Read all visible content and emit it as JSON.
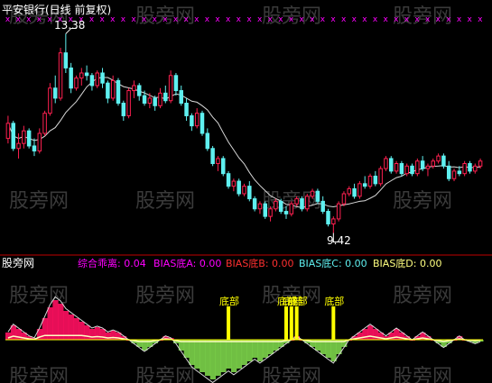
{
  "header": {
    "title": "平安银行(日线 前复权)"
  },
  "watermark": {
    "text": "股旁网"
  },
  "colors": {
    "background": "#000000",
    "up": "#ff2050",
    "down": "#5ff0f0",
    "divider": "#c00000",
    "ma_line": "#d8d8d8",
    "signal": "#ff00ff",
    "bias_pos": "#ff1060",
    "bias_neg": "#7cd44a",
    "bias_line": "#ffffc0",
    "bottom_marker": "#ffff00"
  },
  "chart_data": [
    {
      "type": "candlestick",
      "title": "平安银行(日线 前复权)",
      "annotations": {
        "high": "13.38",
        "low": "9.42"
      },
      "top_markers": "x",
      "ohlc": [
        [
          11.3,
          11.75,
          11.2,
          11.6
        ],
        [
          11.6,
          11.65,
          11.05,
          11.1
        ],
        [
          11.1,
          11.4,
          10.9,
          11.2
        ],
        [
          11.2,
          11.55,
          11.1,
          11.45
        ],
        [
          11.45,
          11.5,
          11.1,
          11.15
        ],
        [
          11.15,
          11.3,
          10.95,
          11.05
        ],
        [
          11.05,
          11.5,
          11.0,
          11.4
        ],
        [
          11.4,
          11.85,
          11.35,
          11.8
        ],
        [
          11.8,
          12.4,
          11.75,
          12.3
        ],
        [
          12.3,
          12.55,
          12.0,
          12.1
        ],
        [
          12.1,
          13.1,
          12.05,
          13.0
        ],
        [
          13.0,
          13.38,
          12.6,
          12.7
        ],
        [
          12.7,
          12.8,
          12.2,
          12.3
        ],
        [
          12.3,
          12.55,
          12.25,
          12.5
        ],
        [
          12.5,
          12.7,
          12.35,
          12.6
        ],
        [
          12.6,
          12.75,
          12.45,
          12.55
        ],
        [
          12.55,
          12.6,
          12.25,
          12.35
        ],
        [
          12.35,
          12.65,
          12.3,
          12.6
        ],
        [
          12.6,
          12.7,
          12.3,
          12.4
        ],
        [
          12.4,
          12.45,
          12.0,
          12.1
        ],
        [
          12.1,
          12.55,
          12.05,
          12.45
        ],
        [
          12.45,
          12.5,
          11.95,
          12.0
        ],
        [
          12.0,
          12.05,
          11.65,
          11.75
        ],
        [
          11.75,
          12.3,
          11.7,
          12.25
        ],
        [
          12.25,
          12.45,
          12.1,
          12.35
        ],
        [
          12.35,
          12.4,
          12.05,
          12.15
        ],
        [
          12.15,
          12.25,
          11.95,
          12.0
        ],
        [
          12.0,
          12.2,
          11.9,
          12.1
        ],
        [
          12.1,
          12.15,
          11.85,
          11.95
        ],
        [
          11.95,
          12.3,
          11.9,
          12.2
        ],
        [
          12.2,
          12.35,
          12.0,
          12.05
        ],
        [
          12.05,
          12.65,
          12.0,
          12.55
        ],
        [
          12.55,
          12.6,
          12.15,
          12.25
        ],
        [
          12.25,
          12.35,
          11.95,
          12.0
        ],
        [
          12.0,
          12.1,
          11.65,
          11.75
        ],
        [
          11.75,
          11.8,
          11.45,
          11.55
        ],
        [
          11.55,
          11.9,
          11.5,
          11.8
        ],
        [
          11.8,
          11.85,
          11.35,
          11.4
        ],
        [
          11.4,
          11.5,
          11.05,
          11.1
        ],
        [
          11.1,
          11.15,
          10.75,
          10.8
        ],
        [
          10.8,
          10.95,
          10.65,
          10.9
        ],
        [
          10.9,
          10.95,
          10.55,
          10.6
        ],
        [
          10.6,
          10.65,
          10.3,
          10.35
        ],
        [
          10.35,
          10.5,
          10.25,
          10.45
        ],
        [
          10.45,
          10.5,
          10.15,
          10.2
        ],
        [
          10.2,
          10.4,
          10.15,
          10.35
        ],
        [
          10.35,
          10.45,
          10.05,
          10.1
        ],
        [
          10.1,
          10.15,
          9.85,
          9.9
        ],
        [
          9.9,
          10.05,
          9.8,
          10.0
        ],
        [
          10.0,
          10.05,
          9.7,
          9.75
        ],
        [
          9.75,
          9.95,
          9.65,
          9.9
        ],
        [
          9.9,
          10.1,
          9.85,
          10.05
        ],
        [
          10.05,
          10.1,
          9.8,
          9.85
        ],
        [
          9.85,
          9.95,
          9.7,
          9.8
        ],
        [
          9.8,
          10.05,
          9.75,
          10.0
        ],
        [
          10.0,
          10.15,
          9.95,
          10.1
        ],
        [
          10.1,
          10.15,
          9.85,
          9.9
        ],
        [
          9.9,
          10.2,
          9.85,
          10.15
        ],
        [
          10.15,
          10.3,
          10.1,
          10.25
        ],
        [
          10.25,
          10.3,
          10.0,
          10.05
        ],
        [
          10.05,
          10.15,
          9.8,
          9.85
        ],
        [
          9.85,
          9.9,
          9.55,
          9.6
        ],
        [
          9.6,
          9.75,
          9.42,
          9.7
        ],
        [
          9.7,
          10.05,
          9.65,
          10.0
        ],
        [
          10.0,
          10.25,
          9.95,
          10.2
        ],
        [
          10.2,
          10.35,
          10.15,
          10.3
        ],
        [
          10.3,
          10.4,
          10.1,
          10.15
        ],
        [
          10.15,
          10.45,
          10.1,
          10.4
        ],
        [
          10.4,
          10.55,
          10.3,
          10.35
        ],
        [
          10.35,
          10.6,
          10.3,
          10.55
        ],
        [
          10.55,
          10.65,
          10.35,
          10.4
        ],
        [
          10.4,
          10.75,
          10.35,
          10.7
        ],
        [
          10.7,
          10.95,
          10.65,
          10.9
        ],
        [
          10.9,
          10.95,
          10.6,
          10.65
        ],
        [
          10.65,
          10.85,
          10.6,
          10.8
        ],
        [
          10.8,
          10.85,
          10.55,
          10.6
        ],
        [
          10.6,
          10.8,
          10.55,
          10.75
        ],
        [
          10.75,
          10.8,
          10.55,
          10.6
        ],
        [
          10.6,
          10.9,
          10.55,
          10.85
        ],
        [
          10.85,
          10.95,
          10.65,
          10.7
        ],
        [
          10.7,
          10.8,
          10.55,
          10.75
        ],
        [
          10.75,
          10.9,
          10.7,
          10.85
        ],
        [
          10.85,
          11.0,
          10.8,
          10.95
        ],
        [
          10.95,
          11.0,
          10.7,
          10.75
        ],
        [
          10.75,
          10.85,
          10.45,
          10.5
        ],
        [
          10.5,
          10.7,
          10.45,
          10.65
        ],
        [
          10.65,
          10.75,
          10.55,
          10.6
        ],
        [
          10.6,
          10.85,
          10.55,
          10.8
        ],
        [
          10.8,
          10.85,
          10.6,
          10.65
        ],
        [
          10.65,
          10.8,
          10.6,
          10.75
        ],
        [
          10.75,
          10.9,
          10.7,
          10.85
        ]
      ],
      "ylim": [
        9.0,
        13.8
      ]
    },
    {
      "type": "bar",
      "title": "综合乖离",
      "legend": [
        {
          "label": "综合乖离: 0.04",
          "color": "#ff00ff"
        },
        {
          "label": "BIAS底A: 0.00",
          "color": "#ff00ff"
        },
        {
          "label": "BIAS底B: 0.00",
          "color": "#ff3030"
        },
        {
          "label": "BIAS底C: 0.00",
          "color": "#5ff0f0"
        },
        {
          "label": "BIAS底D: 0.00",
          "color": "#ffff80"
        }
      ],
      "signal_label": "底部",
      "signal_bars": [
        42,
        53,
        54,
        55,
        62
      ],
      "values": [
        2,
        4,
        3,
        2,
        1,
        0.5,
        3,
        6,
        9,
        11,
        10,
        8,
        7,
        6,
        5,
        4,
        3,
        3.5,
        3,
        2,
        2.5,
        2,
        1,
        0,
        -1,
        -2,
        -3,
        -2,
        -1,
        0,
        1,
        0.5,
        -1,
        -3,
        -5,
        -7,
        -8,
        -9,
        -10,
        -11,
        -10,
        -9,
        -8,
        -9,
        -8,
        -7,
        -6,
        -5,
        -6,
        -5,
        -4,
        -3,
        -2,
        -1,
        0,
        1,
        0,
        -1,
        -2,
        -3,
        -4,
        -5,
        -6,
        -4,
        -2,
        0,
        1,
        2,
        3,
        4,
        3,
        2,
        1,
        2,
        3,
        2,
        1,
        0,
        1,
        2,
        1,
        0,
        -1,
        -2,
        -1,
        0,
        1,
        0,
        -0.5,
        -1,
        -0.5
      ],
      "ylim": [
        -12,
        12
      ]
    }
  ]
}
